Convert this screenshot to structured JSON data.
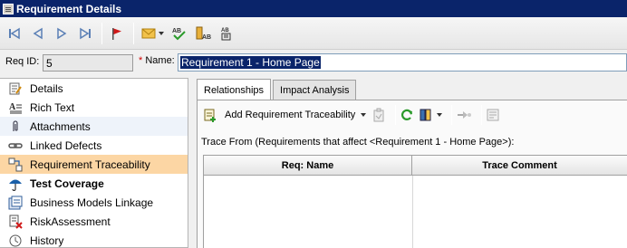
{
  "window": {
    "title": "Requirement Details"
  },
  "fields": {
    "req_id_label": "Req ID:",
    "req_id_value": "5",
    "name_required_mark": "*",
    "name_label": "Name:",
    "name_value": "Requirement 1 - Home Page"
  },
  "toolbar": {
    "buttons": [
      "first-record",
      "previous-record",
      "next-record",
      "last-record",
      "flag",
      "send-email",
      "spell-check",
      "thesaurus",
      "spelling-options"
    ]
  },
  "sidebar": {
    "items": [
      {
        "label": "Details",
        "icon": "details-icon"
      },
      {
        "label": "Rich Text",
        "icon": "rich-text-icon"
      },
      {
        "label": "Attachments",
        "icon": "paperclip-icon"
      },
      {
        "label": "Linked Defects",
        "icon": "link-icon"
      },
      {
        "label": "Requirement Traceability",
        "icon": "traceability-icon",
        "selected": true
      },
      {
        "label": "Test Coverage",
        "icon": "umbrella-icon",
        "bold": true
      },
      {
        "label": "Business Models Linkage",
        "icon": "business-model-icon"
      },
      {
        "label": "RiskAssessment",
        "icon": "risk-icon"
      },
      {
        "label": "History",
        "icon": "history-icon"
      }
    ]
  },
  "tabs": [
    {
      "label": "Relationships",
      "active": true
    },
    {
      "label": "Impact Analysis"
    }
  ],
  "relationships": {
    "add_traceability_label": "Add Requirement Traceability",
    "trace_from_text": "Trace From (Requirements that affect <Requirement 1 - Home Page>):",
    "columns": [
      "Req: Name",
      "Trace Comment"
    ],
    "rows": []
  },
  "colors": {
    "titlebar": "#0a246a",
    "selected_item": "#fcd6a4",
    "required_mark": "#d00000"
  }
}
